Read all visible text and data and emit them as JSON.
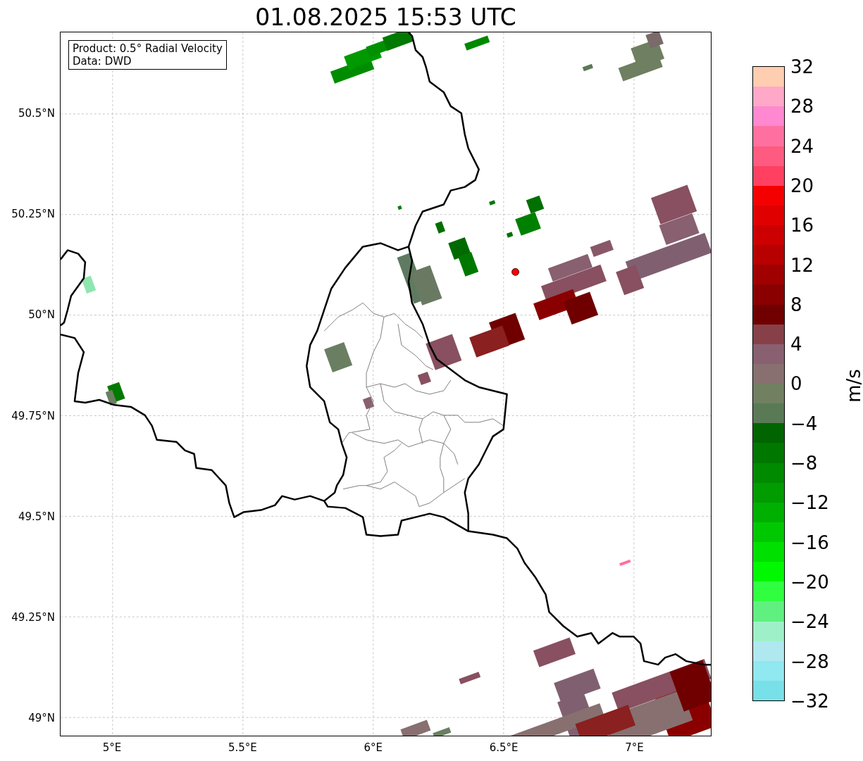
{
  "title": "01.08.2025 15:53 UTC",
  "legend": [
    "Product: 0.5° Radial Velocity",
    "Data: DWD"
  ],
  "map": {
    "lat_labels": [
      "50.5°N",
      "50.25°N",
      "50°N",
      "49.75°N",
      "49.5°N",
      "49.25°N",
      "49°N"
    ],
    "lon_labels": [
      "5°E",
      "5.5°E",
      "6°E",
      "6.5°E",
      "7°E"
    ]
  },
  "colorbar": {
    "label": "m/s",
    "ticks": [
      "32",
      "28",
      "24",
      "20",
      "16",
      "12",
      "8",
      "4",
      "0",
      "−4",
      "−8",
      "−12",
      "−16",
      "−20",
      "−24",
      "−28",
      "−32"
    ],
    "bands": [
      {
        "color": "#ffcdb0"
      },
      {
        "color": "#ffa8c8"
      },
      {
        "color": "#ff88d0"
      },
      {
        "color": "#ff70a0"
      },
      {
        "color": "#ff5a80"
      },
      {
        "color": "#ff4060"
      },
      {
        "color": "#f50000"
      },
      {
        "color": "#e00000"
      },
      {
        "color": "#cc0000"
      },
      {
        "color": "#b80000"
      },
      {
        "color": "#a00000"
      },
      {
        "color": "#8a0000"
      },
      {
        "color": "#700000"
      },
      {
        "color": "#884048"
      },
      {
        "color": "#886070"
      },
      {
        "color": "#887070"
      },
      {
        "color": "#708060"
      },
      {
        "color": "#5a7a55"
      },
      {
        "color": "#006400"
      },
      {
        "color": "#007800"
      },
      {
        "color": "#008a00"
      },
      {
        "color": "#009c00"
      },
      {
        "color": "#00b000"
      },
      {
        "color": "#00c800"
      },
      {
        "color": "#00e000"
      },
      {
        "color": "#00f800"
      },
      {
        "color": "#30ff40"
      },
      {
        "color": "#60f080"
      },
      {
        "color": "#9ef0c8"
      },
      {
        "color": "#b0e8f0"
      },
      {
        "color": "#90e8f0"
      },
      {
        "color": "#78e0e8"
      }
    ]
  }
}
